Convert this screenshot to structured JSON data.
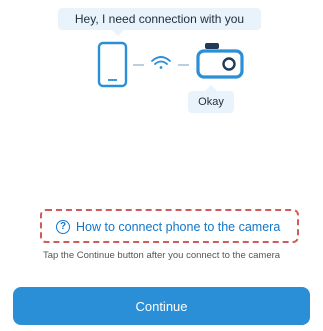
{
  "dialog": {
    "phone_message": "Hey, I need connection with you",
    "camera_reply": "Okay"
  },
  "help": {
    "link_label": "How to connect phone to the camera",
    "icon": "question-circle-icon"
  },
  "hint_text": "Tap the Continue button after you connect to the camera",
  "continue_label": "Continue",
  "colors": {
    "accent": "#2a8fd7",
    "link": "#1576c8",
    "dashed_border": "#d45a5a",
    "bubble_bg": "#e9f3fb"
  }
}
